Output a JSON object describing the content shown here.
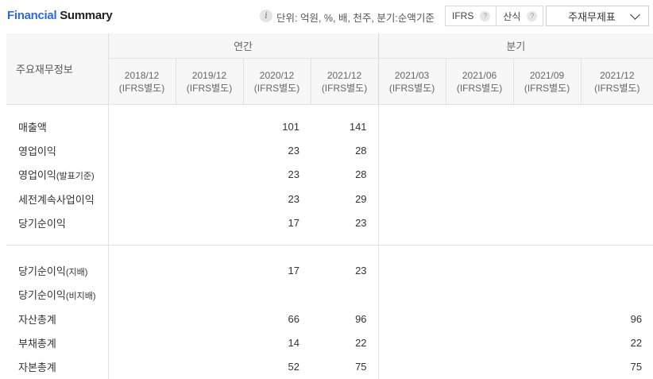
{
  "header": {
    "title_part1": "Financial",
    "title_part2": " Summary",
    "info_icon": "i",
    "unit_text": "단위: 억원, %, 배, 천주, 분기:순액기준",
    "seg": [
      {
        "label": "IFRS",
        "help": "?"
      },
      {
        "label": "산식",
        "help": "?"
      }
    ],
    "select_value": "주재무제표"
  },
  "table": {
    "row_header": "주요재무정보",
    "groups": [
      {
        "label": "연간"
      },
      {
        "label": "분기"
      }
    ],
    "periods": [
      {
        "date": "2018/12",
        "basis": "(IFRS별도)"
      },
      {
        "date": "2019/12",
        "basis": "(IFRS별도)"
      },
      {
        "date": "2020/12",
        "basis": "(IFRS별도)"
      },
      {
        "date": "2021/12",
        "basis": "(IFRS별도)"
      },
      {
        "date": "2021/03",
        "basis": "(IFRS별도)"
      },
      {
        "date": "2021/06",
        "basis": "(IFRS별도)"
      },
      {
        "date": "2021/09",
        "basis": "(IFRS별도)"
      },
      {
        "date": "2021/12",
        "basis": "(IFRS별도)"
      }
    ],
    "rows_a": [
      {
        "label": "매출액",
        "suffix": "",
        "v": [
          "",
          "",
          "101",
          "141",
          "",
          "",
          "",
          ""
        ]
      },
      {
        "label": "영업이익",
        "suffix": "",
        "v": [
          "",
          "",
          "23",
          "28",
          "",
          "",
          "",
          ""
        ]
      },
      {
        "label": "영업이익",
        "suffix": "(발표기준)",
        "v": [
          "",
          "",
          "23",
          "28",
          "",
          "",
          "",
          ""
        ]
      },
      {
        "label": "세전계속사업이익",
        "suffix": "",
        "v": [
          "",
          "",
          "23",
          "29",
          "",
          "",
          "",
          ""
        ]
      },
      {
        "label": "당기순이익",
        "suffix": "",
        "v": [
          "",
          "",
          "17",
          "23",
          "",
          "",
          "",
          ""
        ]
      }
    ],
    "rows_b": [
      {
        "label": "당기순이익",
        "suffix": "(지배)",
        "v": [
          "",
          "",
          "17",
          "23",
          "",
          "",
          "",
          ""
        ]
      },
      {
        "label": "당기순이익",
        "suffix": "(비지배)",
        "v": [
          "",
          "",
          "",
          "",
          "",
          "",
          "",
          ""
        ]
      },
      {
        "label": "자산총계",
        "suffix": "",
        "v": [
          "",
          "",
          "66",
          "96",
          "",
          "",
          "",
          "96"
        ]
      },
      {
        "label": "부채총계",
        "suffix": "",
        "v": [
          "",
          "",
          "14",
          "22",
          "",
          "",
          "",
          "22"
        ]
      },
      {
        "label": "자본총계",
        "suffix": "",
        "v": [
          "",
          "",
          "52",
          "75",
          "",
          "",
          "",
          "75"
        ]
      }
    ]
  }
}
